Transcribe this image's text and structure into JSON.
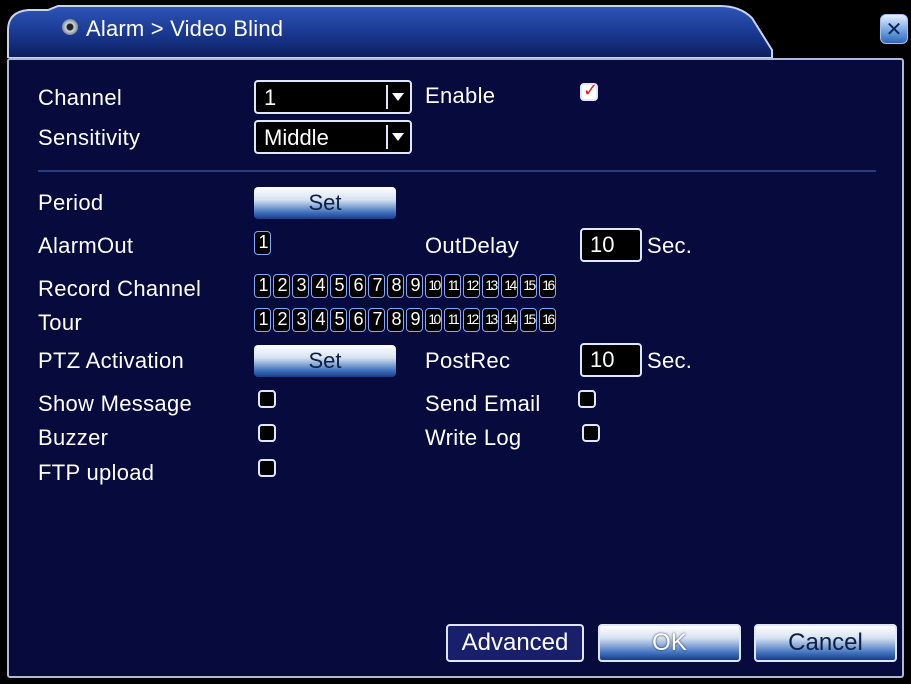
{
  "window": {
    "title": "Alarm > Video Blind",
    "title_icon": "disc-icon",
    "close_icon": "close-icon",
    "accent": "#1b3a93"
  },
  "form": {
    "channel_label": "Channel",
    "channel_value": "1",
    "enable_label": "Enable",
    "enable_checked": true,
    "sensitivity_label": "Sensitivity",
    "sensitivity_value": "Middle",
    "period_label": "Period",
    "period_button": "Set",
    "alarmout_label": "AlarmOut",
    "alarmout_channels": [
      "1"
    ],
    "outdelay_label": "OutDelay",
    "outdelay_value": "10",
    "outdelay_unit": "Sec.",
    "record_channel_label": "Record Channel",
    "record_channels": [
      "1",
      "2",
      "3",
      "4",
      "5",
      "6",
      "7",
      "8",
      "9",
      "10",
      "11",
      "12",
      "13",
      "14",
      "15",
      "16"
    ],
    "tour_label": "Tour",
    "tour_channels": [
      "1",
      "2",
      "3",
      "4",
      "5",
      "6",
      "7",
      "8",
      "9",
      "10",
      "11",
      "12",
      "13",
      "14",
      "15",
      "16"
    ],
    "ptz_label": "PTZ Activation",
    "ptz_button": "Set",
    "postrec_label": "PostRec",
    "postrec_value": "10",
    "postrec_unit": "Sec.",
    "show_message_label": "Show Message",
    "send_email_label": "Send Email",
    "buzzer_label": "Buzzer",
    "write_log_label": "Write Log",
    "ftp_upload_label": "FTP upload"
  },
  "buttons": {
    "advanced": "Advanced",
    "ok": "OK",
    "cancel": "Cancel"
  }
}
